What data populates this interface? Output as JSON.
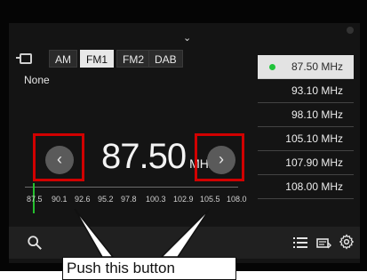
{
  "bands": [
    "AM",
    "FM1",
    "FM2",
    "DAB"
  ],
  "active_band": "FM1",
  "station_name": "None",
  "current_frequency": "87.50",
  "frequency_unit": "MHz",
  "prev_symbol": "‹",
  "next_symbol": "›",
  "top_chevron": "⌄",
  "scale_labels": [
    "87.5",
    "90.1",
    "92.6",
    "95.2",
    "97.8",
    "100.3",
    "102.9",
    "105.5",
    "108.0"
  ],
  "presets": [
    "87.50 MHz",
    "93.10 MHz",
    "98.10 MHz",
    "105.10 MHz",
    "107.90 MHz",
    "108.00 MHz"
  ],
  "active_preset_index": 0,
  "callout_text": "Push this button",
  "colors": {
    "highlight": "#d10000",
    "active_dot": "#20c33a",
    "cursor": "#25c02e"
  },
  "icons": [
    "source-icon",
    "search-icon",
    "list-icon",
    "radio-source-icon",
    "gear-icon",
    "chevron-down-icon",
    "prev-icon",
    "next-icon"
  ]
}
